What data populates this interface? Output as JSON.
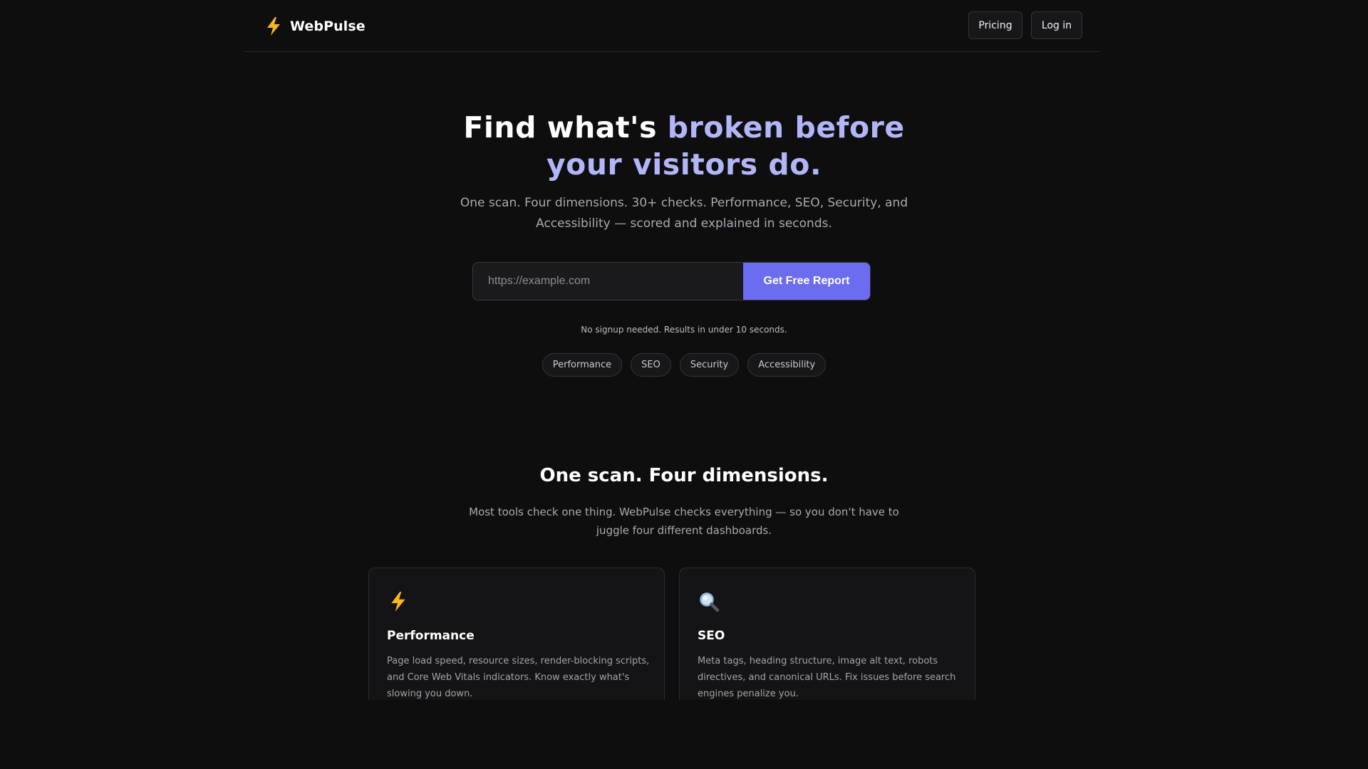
{
  "brand": {
    "name": "WebPulse",
    "icon": "lightning-bolt-icon"
  },
  "nav": {
    "pricing_label": "Pricing",
    "login_label": "Log in"
  },
  "hero": {
    "title_plain": "Find what's",
    "title_accent_1": "broken before",
    "title_accent_2": "your visitors do.",
    "subtitle": "One scan. Four dimensions. 30+ checks. Performance, SEO, Security, and Accessibility — scored and explained in seconds."
  },
  "scan_form": {
    "url_placeholder": "https://example.com",
    "url_value": "",
    "submit_label": "Get Free Report"
  },
  "note": "No signup needed. Results in under 10 seconds.",
  "pills": [
    "Performance",
    "SEO",
    "Security",
    "Accessibility"
  ],
  "features_section": {
    "title": "One scan. Four dimensions.",
    "subtitle": "Most tools check one thing. WebPulse checks everything — so you don't have to juggle four different dashboards.",
    "cards": [
      {
        "icon": "lightning-bolt-icon",
        "title": "Performance",
        "description": "Page load speed, resource sizes, render-blocking scripts, and Core Web Vitals indicators. Know exactly what's slowing you down."
      },
      {
        "icon": "magnifying-glass-icon",
        "title": "SEO",
        "description": "Meta tags, heading structure, image alt text, robots directives, and canonical URLs. Fix issues before search engines penalize you."
      }
    ]
  },
  "colors": {
    "background": "#0e0e0f",
    "accent": "#6b6cf0",
    "title_accent": "#b2b5f7",
    "bolt": "#f5b623"
  }
}
